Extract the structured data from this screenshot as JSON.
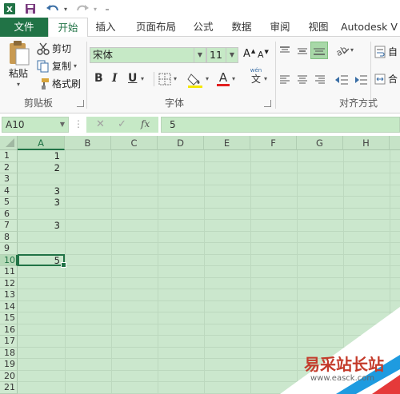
{
  "title_bar": {
    "customize_label": "₌"
  },
  "tabs": [
    "文件",
    "开始",
    "插入",
    "页面布局",
    "公式",
    "数据",
    "审阅",
    "视图",
    "Autodesk V"
  ],
  "clipboard": {
    "paste": "粘贴",
    "cut": "剪切",
    "copy": "复制",
    "format_painter": "格式刷",
    "group_label": "剪贴板"
  },
  "font": {
    "name": "宋体",
    "size": "11",
    "group_label": "字体",
    "bold": "B",
    "italic": "I",
    "underline": "U",
    "grow": "A",
    "shrink": "A",
    "phonetic": "wén",
    "phonetic_char": "文"
  },
  "alignment": {
    "group_label": "对齐方式",
    "wrap": "自",
    "merge": "合"
  },
  "formula_bar": {
    "name_box": "A10",
    "fx": "fx",
    "value": "5"
  },
  "columns": [
    "A",
    "B",
    "C",
    "D",
    "E",
    "F",
    "G",
    "H"
  ],
  "rows": [
    "1",
    "2",
    "3",
    "4",
    "5",
    "6",
    "7",
    "8",
    "9",
    "10",
    "11",
    "12",
    "13",
    "14",
    "15",
    "16",
    "17",
    "18",
    "19",
    "20",
    "21"
  ],
  "cells": [
    {
      "row": 1,
      "value": "1"
    },
    {
      "row": 2,
      "value": "2"
    },
    {
      "row": 4,
      "value": "3"
    },
    {
      "row": 5,
      "value": "3"
    },
    {
      "row": 7,
      "value": "3"
    },
    {
      "row": 10,
      "value": "5"
    }
  ],
  "watermark": {
    "text": "易采站长站",
    "url": "www.easck.com"
  },
  "colors": {
    "accent": "#217346",
    "sheet_bg": "#cbe7cd",
    "selected_row": "#217346"
  }
}
